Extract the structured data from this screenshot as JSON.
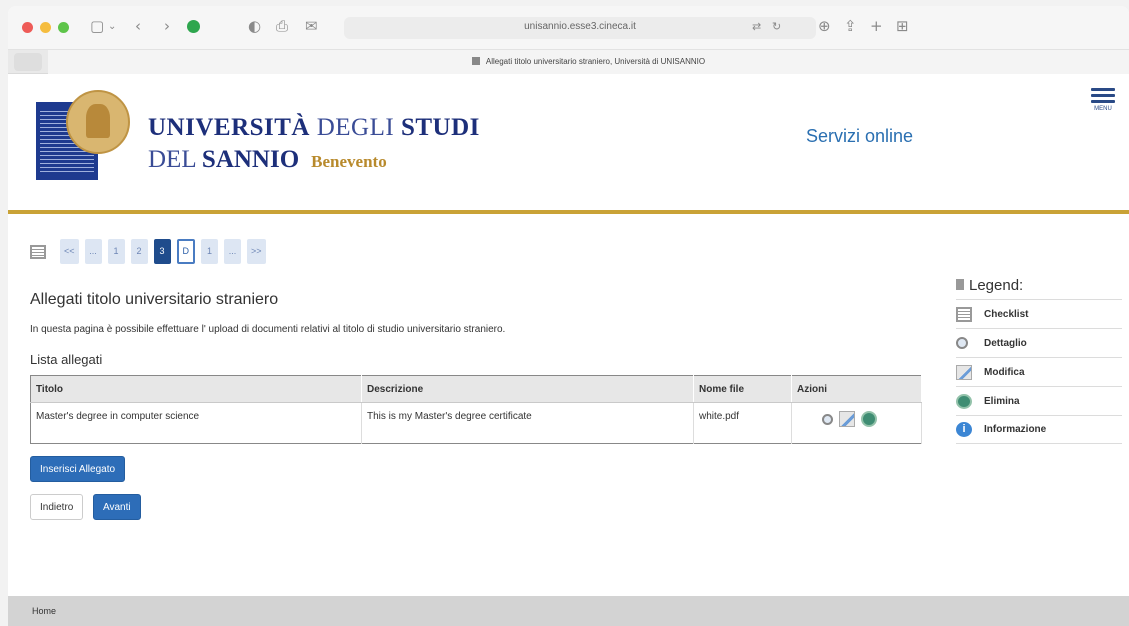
{
  "browser": {
    "url": "unisannio.esse3.cineca.it",
    "tab_title": "Allegati titolo universitario straniero, Università di UNISANNIO"
  },
  "header": {
    "logo_line1_bold": "UNIVERSITÀ",
    "logo_line1_light": "DEGLI",
    "logo_line1_bold2": "STUDI",
    "logo_line2_light": "DEL",
    "logo_line2_bold": "SANNIO",
    "logo_city": "Benevento",
    "servizi": "Servizi online",
    "menu_label": "MENU"
  },
  "pager": {
    "items": [
      "<<",
      "...",
      "1",
      "2",
      "3",
      "D",
      "1",
      "...",
      ">>"
    ]
  },
  "main": {
    "title": "Allegati titolo universitario straniero",
    "intro": "In questa pagina è possibile effettuare l' upload di documenti relativi al titolo di studio universitario straniero.",
    "list_title": "Lista allegati",
    "table": {
      "headers": [
        "Titolo",
        "Descrizione",
        "Nome file",
        "Azioni"
      ],
      "rows": [
        [
          "Master's degree in computer science",
          "This is my Master's degree certificate",
          "white.pdf"
        ]
      ]
    },
    "insert_button": "Inserisci Allegato",
    "back_button": "Indietro",
    "next_button": "Avanti"
  },
  "legend": {
    "title": "Legend:",
    "items": [
      "Checklist",
      "Dettaglio",
      "Modifica",
      "Elimina",
      "Informazione"
    ]
  },
  "footer": {
    "home": "Home"
  },
  "colors": {
    "gold_rule": "#c9a236",
    "primary": "#2d6db8",
    "servizi_blue": "#2a6fb1"
  }
}
